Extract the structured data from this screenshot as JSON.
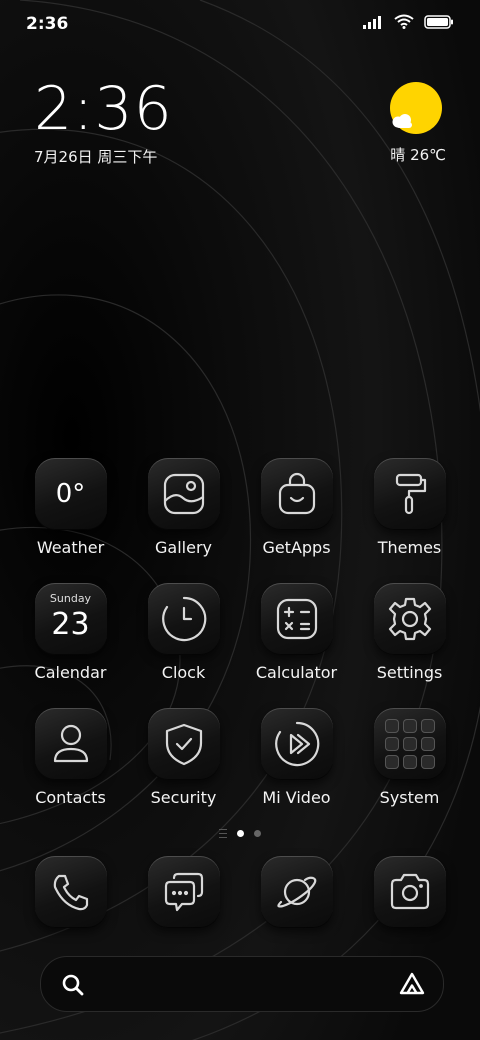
{
  "status_bar": {
    "time": "2:36"
  },
  "clock_widget": {
    "time": "2:36",
    "date": "7月26日 周三下午"
  },
  "weather_widget": {
    "condition_temp": "晴 26℃",
    "icon": "sun-cloud-icon",
    "sun_color": "#ffd400"
  },
  "apps": [
    {
      "label": "Weather",
      "icon": "weather-icon",
      "tile_text": "0°"
    },
    {
      "label": "Gallery",
      "icon": "gallery-icon"
    },
    {
      "label": "GetApps",
      "icon": "shopping-bag-icon"
    },
    {
      "label": "Themes",
      "icon": "paint-roller-icon"
    },
    {
      "label": "Calendar",
      "icon": "calendar-icon",
      "day": "Sunday",
      "date": "23"
    },
    {
      "label": "Clock",
      "icon": "clock-icon"
    },
    {
      "label": "Calculator",
      "icon": "calculator-icon"
    },
    {
      "label": "Settings",
      "icon": "gear-icon"
    },
    {
      "label": "Contacts",
      "icon": "person-icon"
    },
    {
      "label": "Security",
      "icon": "shield-check-icon"
    },
    {
      "label": "Mi Video",
      "icon": "play-icon"
    },
    {
      "label": "System",
      "icon": "folder-icon"
    }
  ],
  "page_indicator": {
    "pages": 2,
    "active": 1
  },
  "dock": [
    {
      "name": "phone",
      "icon": "phone-icon"
    },
    {
      "name": "messages",
      "icon": "chat-icon"
    },
    {
      "name": "browser",
      "icon": "planet-icon"
    },
    {
      "name": "camera",
      "icon": "camera-icon"
    }
  ],
  "search_bar": {
    "left_icon": "search-icon",
    "right_icon": "assistant-icon"
  }
}
